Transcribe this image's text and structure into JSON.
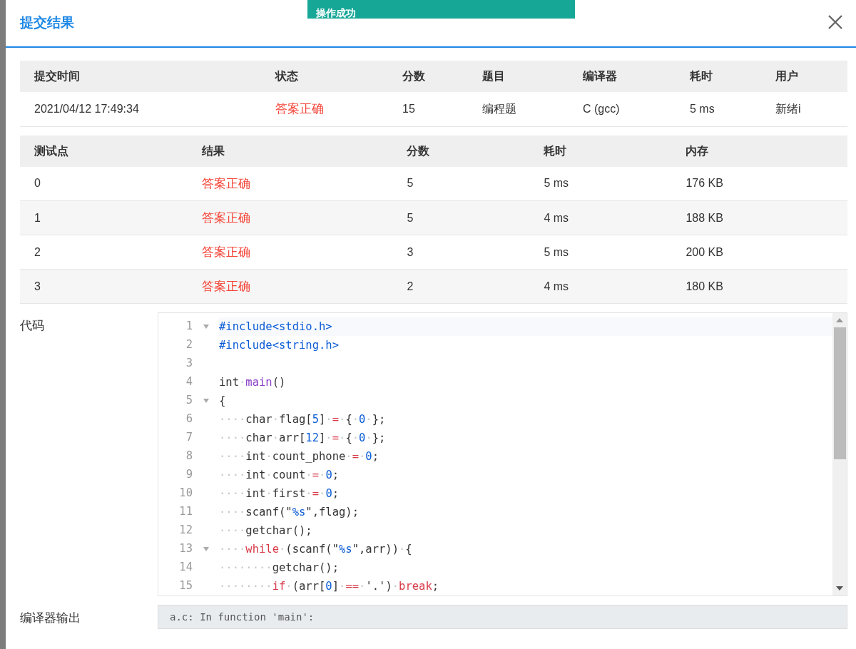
{
  "toast": {
    "message": "操作成功"
  },
  "dialog": {
    "title": "提交结果"
  },
  "submission": {
    "columns": [
      "提交时间",
      "状态",
      "分数",
      "题目",
      "编译器",
      "耗时",
      "用户"
    ],
    "row": [
      {
        "text": "2021/04/12 17:49:34",
        "kind": "plain"
      },
      {
        "text": "答案正确",
        "kind": "accepted"
      },
      {
        "text": "15",
        "kind": "plain"
      },
      {
        "text": "编程题",
        "kind": "plain"
      },
      {
        "text": "C (gcc)",
        "kind": "plain"
      },
      {
        "text": "5 ms",
        "kind": "plain"
      },
      {
        "text": "新绪i",
        "kind": "plain"
      }
    ]
  },
  "testcases": {
    "columns": [
      "测试点",
      "结果",
      "分数",
      "耗时",
      "内存"
    ],
    "rows": [
      {
        "cells": [
          {
            "text": "0",
            "kind": "plain"
          },
          {
            "text": "答案正确",
            "kind": "accepted"
          },
          {
            "text": "5",
            "kind": "plain"
          },
          {
            "text": "5 ms",
            "kind": "plain"
          },
          {
            "text": "176 KB",
            "kind": "plain"
          }
        ]
      },
      {
        "cells": [
          {
            "text": "1",
            "kind": "plain"
          },
          {
            "text": "答案正确",
            "kind": "accepted"
          },
          {
            "text": "5",
            "kind": "plain"
          },
          {
            "text": "4 ms",
            "kind": "plain"
          },
          {
            "text": "188 KB",
            "kind": "plain"
          }
        ]
      },
      {
        "cells": [
          {
            "text": "2",
            "kind": "plain"
          },
          {
            "text": "答案正确",
            "kind": "accepted"
          },
          {
            "text": "3",
            "kind": "plain"
          },
          {
            "text": "5 ms",
            "kind": "plain"
          },
          {
            "text": "200 KB",
            "kind": "plain"
          }
        ]
      },
      {
        "cells": [
          {
            "text": "3",
            "kind": "plain"
          },
          {
            "text": "答案正确",
            "kind": "accepted"
          },
          {
            "text": "2",
            "kind": "plain"
          },
          {
            "text": "4 ms",
            "kind": "plain"
          },
          {
            "text": "180 KB",
            "kind": "plain"
          }
        ]
      }
    ]
  },
  "code": {
    "label": "代码",
    "lines": [
      {
        "number": "1",
        "foldable": true,
        "tokens": [
          {
            "kind": "directive",
            "text": "#include<stdio.h>"
          }
        ]
      },
      {
        "number": "2",
        "foldable": false,
        "tokens": [
          {
            "kind": "directive",
            "text": "#include<string.h>"
          }
        ]
      },
      {
        "number": "3",
        "foldable": false
      },
      {
        "number": "4",
        "foldable": false,
        "tokens": [
          {
            "kind": "plain",
            "text": "int"
          },
          {
            "kind": "ws",
            "text": "·"
          },
          {
            "kind": "function",
            "text": "main"
          },
          {
            "kind": "plain",
            "text": "()"
          }
        ]
      },
      {
        "number": "5",
        "foldable": true,
        "tokens": [
          {
            "kind": "plain",
            "text": "{"
          }
        ]
      },
      {
        "number": "6",
        "foldable": false,
        "tokens": [
          {
            "kind": "ws",
            "text": "····"
          },
          {
            "kind": "plain",
            "text": "char"
          },
          {
            "kind": "ws",
            "text": "·"
          },
          {
            "kind": "plain",
            "text": "flag["
          },
          {
            "kind": "number",
            "text": "5"
          },
          {
            "kind": "plain",
            "text": "]"
          },
          {
            "kind": "ws",
            "text": "·"
          },
          {
            "kind": "operator",
            "text": "="
          },
          {
            "kind": "ws",
            "text": "·"
          },
          {
            "kind": "plain",
            "text": "{"
          },
          {
            "kind": "ws",
            "text": "·"
          },
          {
            "kind": "number",
            "text": "0"
          },
          {
            "kind": "ws",
            "text": "·"
          },
          {
            "kind": "plain",
            "text": "};"
          }
        ]
      },
      {
        "number": "7",
        "foldable": false,
        "tokens": [
          {
            "kind": "ws",
            "text": "····"
          },
          {
            "kind": "plain",
            "text": "char"
          },
          {
            "kind": "ws",
            "text": "·"
          },
          {
            "kind": "plain",
            "text": "arr["
          },
          {
            "kind": "number",
            "text": "12"
          },
          {
            "kind": "plain",
            "text": "]"
          },
          {
            "kind": "ws",
            "text": "·"
          },
          {
            "kind": "operator",
            "text": "="
          },
          {
            "kind": "ws",
            "text": "·"
          },
          {
            "kind": "plain",
            "text": "{"
          },
          {
            "kind": "ws",
            "text": "·"
          },
          {
            "kind": "number",
            "text": "0"
          },
          {
            "kind": "ws",
            "text": "·"
          },
          {
            "kind": "plain",
            "text": "};"
          }
        ]
      },
      {
        "number": "8",
        "foldable": false,
        "tokens": [
          {
            "kind": "ws",
            "text": "····"
          },
          {
            "kind": "plain",
            "text": "int"
          },
          {
            "kind": "ws",
            "text": "·"
          },
          {
            "kind": "plain",
            "text": "count_phone"
          },
          {
            "kind": "ws",
            "text": "·"
          },
          {
            "kind": "operator",
            "text": "="
          },
          {
            "kind": "ws",
            "text": "·"
          },
          {
            "kind": "number",
            "text": "0"
          },
          {
            "kind": "plain",
            "text": ";"
          }
        ]
      },
      {
        "number": "9",
        "foldable": false,
        "tokens": [
          {
            "kind": "ws",
            "text": "····"
          },
          {
            "kind": "plain",
            "text": "int"
          },
          {
            "kind": "ws",
            "text": "·"
          },
          {
            "kind": "plain",
            "text": "count"
          },
          {
            "kind": "ws",
            "text": "·"
          },
          {
            "kind": "operator",
            "text": "="
          },
          {
            "kind": "ws",
            "text": "·"
          },
          {
            "kind": "number",
            "text": "0"
          },
          {
            "kind": "plain",
            "text": ";"
          }
        ]
      },
      {
        "number": "10",
        "foldable": false,
        "tokens": [
          {
            "kind": "ws",
            "text": "····"
          },
          {
            "kind": "plain",
            "text": "int"
          },
          {
            "kind": "ws",
            "text": "·"
          },
          {
            "kind": "plain",
            "text": "first"
          },
          {
            "kind": "ws",
            "text": "·"
          },
          {
            "kind": "operator",
            "text": "="
          },
          {
            "kind": "ws",
            "text": "·"
          },
          {
            "kind": "number",
            "text": "0"
          },
          {
            "kind": "plain",
            "text": ";"
          }
        ]
      },
      {
        "number": "11",
        "foldable": false,
        "tokens": [
          {
            "kind": "ws",
            "text": "····"
          },
          {
            "kind": "plain",
            "text": "scanf(\""
          },
          {
            "kind": "number",
            "text": "%s"
          },
          {
            "kind": "plain",
            "text": "\",flag);"
          }
        ]
      },
      {
        "number": "12",
        "foldable": false,
        "tokens": [
          {
            "kind": "ws",
            "text": "····"
          },
          {
            "kind": "plain",
            "text": "getchar();"
          }
        ]
      },
      {
        "number": "13",
        "foldable": true,
        "tokens": [
          {
            "kind": "ws",
            "text": "····"
          },
          {
            "kind": "keyword",
            "text": "while"
          },
          {
            "kind": "ws",
            "text": "·"
          },
          {
            "kind": "plain",
            "text": "(scanf(\""
          },
          {
            "kind": "number",
            "text": "%s"
          },
          {
            "kind": "plain",
            "text": "\",arr))"
          },
          {
            "kind": "ws",
            "text": "·"
          },
          {
            "kind": "plain",
            "text": "{"
          }
        ]
      },
      {
        "number": "14",
        "foldable": false,
        "tokens": [
          {
            "kind": "ws",
            "text": "········"
          },
          {
            "kind": "plain",
            "text": "getchar();"
          }
        ]
      },
      {
        "number": "15",
        "foldable": false,
        "tokens": [
          {
            "kind": "ws",
            "text": "········"
          },
          {
            "kind": "keyword",
            "text": "if"
          },
          {
            "kind": "ws",
            "text": "·"
          },
          {
            "kind": "plain",
            "text": "(arr["
          },
          {
            "kind": "number",
            "text": "0"
          },
          {
            "kind": "plain",
            "text": "]"
          },
          {
            "kind": "ws",
            "text": "·"
          },
          {
            "kind": "operator",
            "text": "=="
          },
          {
            "kind": "ws",
            "text": "·"
          },
          {
            "kind": "plain",
            "text": "'.')"
          },
          {
            "kind": "ws",
            "text": "·"
          },
          {
            "kind": "keyword",
            "text": "break"
          },
          {
            "kind": "plain",
            "text": ";"
          }
        ]
      }
    ]
  },
  "compiler_output": {
    "label": "编译器输出",
    "text": "a.c: In function 'main':"
  }
}
